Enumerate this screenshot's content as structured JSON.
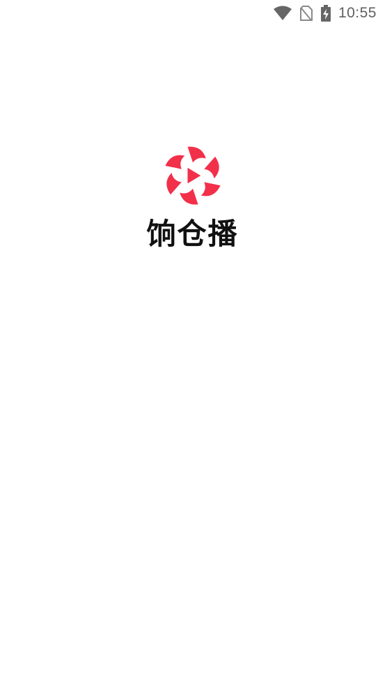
{
  "status_bar": {
    "time": "10:55",
    "icons": [
      "wifi-icon",
      "no-sim-icon",
      "battery-charging-icon"
    ],
    "icon_color": "#666666"
  },
  "splash": {
    "app_name": "饷仓播",
    "logo_icon": "play-pinwheel-logo",
    "brand_color": "#f2304a"
  }
}
